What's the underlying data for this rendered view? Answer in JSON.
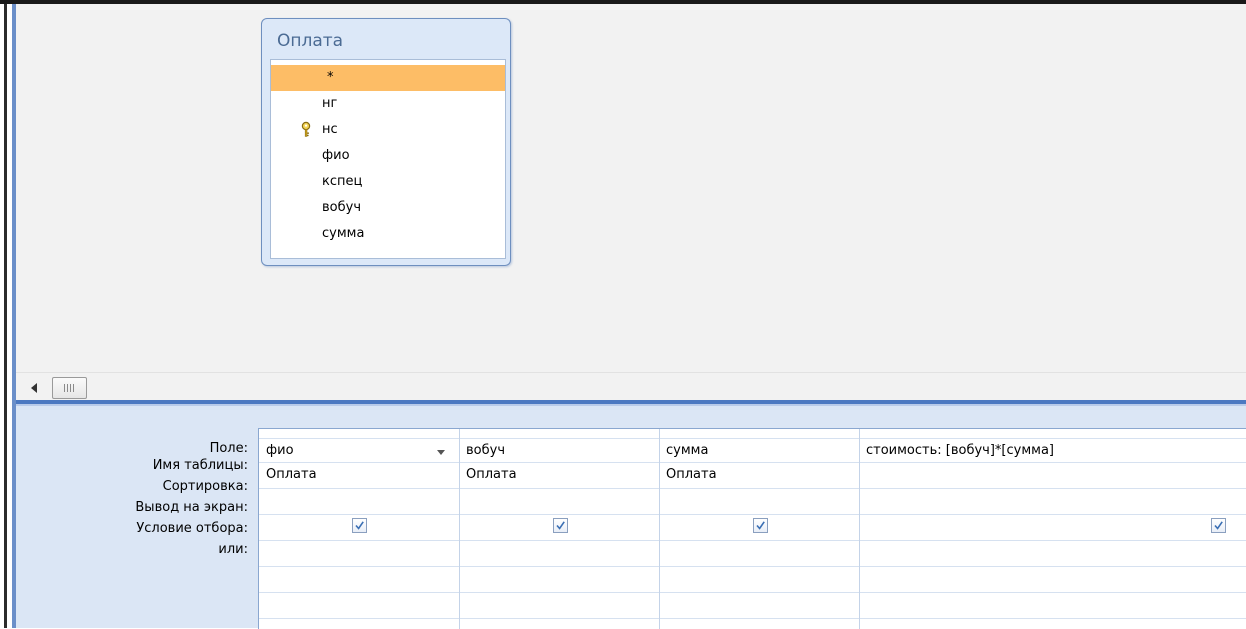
{
  "table": {
    "title": "Оплата",
    "fields": [
      {
        "name": "*",
        "selected": true,
        "key": false
      },
      {
        "name": "нг",
        "selected": false,
        "key": false
      },
      {
        "name": "нс",
        "selected": false,
        "key": true
      },
      {
        "name": "фио",
        "selected": false,
        "key": false
      },
      {
        "name": "кспец",
        "selected": false,
        "key": false
      },
      {
        "name": "вобуч",
        "selected": false,
        "key": false
      },
      {
        "name": "сумма",
        "selected": false,
        "key": false
      }
    ]
  },
  "grid": {
    "row_labels": {
      "field": "Поле:",
      "table": "Имя таблицы:",
      "sort": "Сортировка:",
      "show": "Вывод на экран:",
      "criteria": "Условие отбора:",
      "or": "или:"
    },
    "columns": [
      {
        "field": "фио",
        "table": "Оплата",
        "show": true
      },
      {
        "field": "вобуч",
        "table": "Оплата",
        "show": true
      },
      {
        "field": "сумма",
        "table": "Оплата",
        "show": true
      },
      {
        "field": "стоимость: [вобуч]*[сумма]",
        "table": "",
        "show": true
      }
    ]
  },
  "colors": {
    "selected_field": "#fdbd66",
    "splitter": "#4c79c1",
    "grid_background": "#dbe6f5"
  },
  "icons": [
    "key-icon",
    "dropdown-arrow-icon",
    "scroll-left-arrow-icon",
    "scroll-thumb-grip-icon",
    "checkmark-icon"
  ]
}
